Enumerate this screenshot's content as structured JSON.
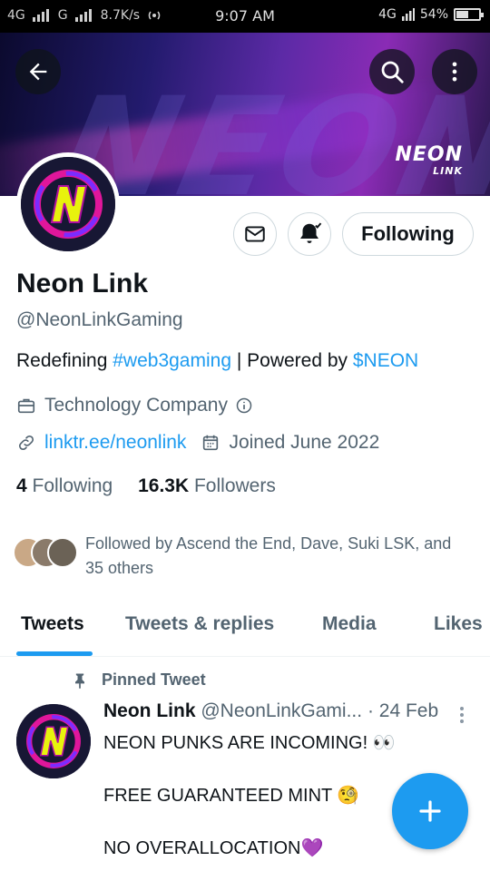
{
  "status_bar": {
    "network": "4G",
    "network2": "G",
    "speed": "8.7K/s",
    "time": "9:07 AM",
    "network_right": "4G",
    "battery": "54%",
    "battery_level": 0.54
  },
  "banner": {
    "brand_top": "NEON",
    "brand_bottom": "LINK"
  },
  "profile": {
    "name": "Neon Link",
    "handle": "@NeonLinkGaming",
    "bio_prefix": "Redefining ",
    "bio_hashtag": "#web3gaming",
    "bio_middle": " | Powered by ",
    "bio_cashtag": "$NEON",
    "category": "Technology Company",
    "website": "linktr.ee/neonlink",
    "joined": "Joined June 2022",
    "following_count": "4",
    "following_label": "Following",
    "followers_count": "16.3K",
    "followers_label": "Followers",
    "follow_button": "Following",
    "followed_by": "Followed by Ascend the End, Dave, Suki LSK, and 35 others"
  },
  "tabs": [
    {
      "label": "Tweets",
      "active": true
    },
    {
      "label": "Tweets & replies",
      "active": false
    },
    {
      "label": "Media",
      "active": false
    },
    {
      "label": "Likes",
      "active": false
    }
  ],
  "tweet": {
    "pinned_label": "Pinned Tweet",
    "author_name": "Neon Link",
    "author_handle": "@NeonLinkGami...",
    "date": "· 24 Feb",
    "line1": "NEON PUNKS ARE INCOMING! 👀",
    "line2": "FREE GUARANTEED MINT 🧐",
    "line3": "NO OVERALLOCATION💜"
  },
  "icons": {
    "back": "back-arrow-icon",
    "search": "search-icon",
    "more": "more-vertical-icon",
    "message": "envelope-icon",
    "notify": "bell-subscribed-icon",
    "category": "briefcase-icon",
    "info": "info-icon",
    "link": "link-icon",
    "calendar": "calendar-icon",
    "pin": "pin-icon",
    "compose": "plus-icon"
  },
  "colors": {
    "accent": "#1d9bf0",
    "logo_yellow": "#e8f20d",
    "logo_pink": "#e0169b",
    "logo_purple": "#7b2cff"
  }
}
